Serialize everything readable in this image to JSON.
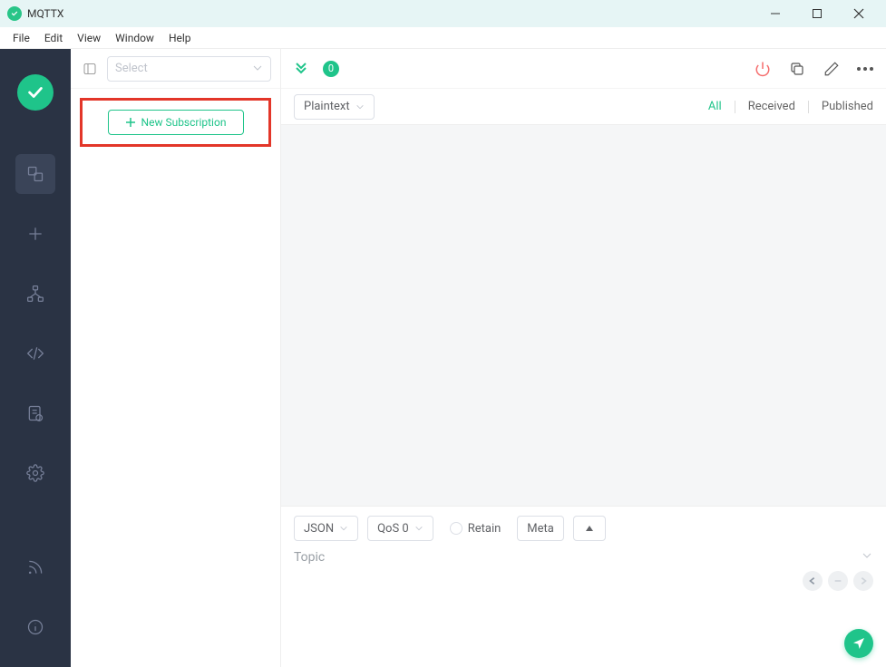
{
  "titlebar": {
    "title": "MQTTX"
  },
  "menubar": {
    "items": [
      "File",
      "Edit",
      "View",
      "Window",
      "Help"
    ]
  },
  "sidebar": {
    "items": [
      {
        "name": "connections-icon",
        "active": true
      },
      {
        "name": "add-icon"
      },
      {
        "name": "topology-icon"
      },
      {
        "name": "code-icon"
      },
      {
        "name": "log-icon"
      },
      {
        "name": "settings-icon"
      }
    ],
    "bottom": [
      {
        "name": "rss-icon"
      },
      {
        "name": "info-icon"
      }
    ]
  },
  "subcol": {
    "select_placeholder": "Select",
    "new_subscription_label": "New Subscription"
  },
  "main_top": {
    "message_count": "0"
  },
  "filter": {
    "format": "Plaintext",
    "tabs": {
      "all": "All",
      "received": "Received",
      "published": "Published"
    }
  },
  "publish": {
    "payload_format": "JSON",
    "qos_label": "QoS 0",
    "retain_label": "Retain",
    "meta_label": "Meta",
    "topic_placeholder": "Topic"
  }
}
